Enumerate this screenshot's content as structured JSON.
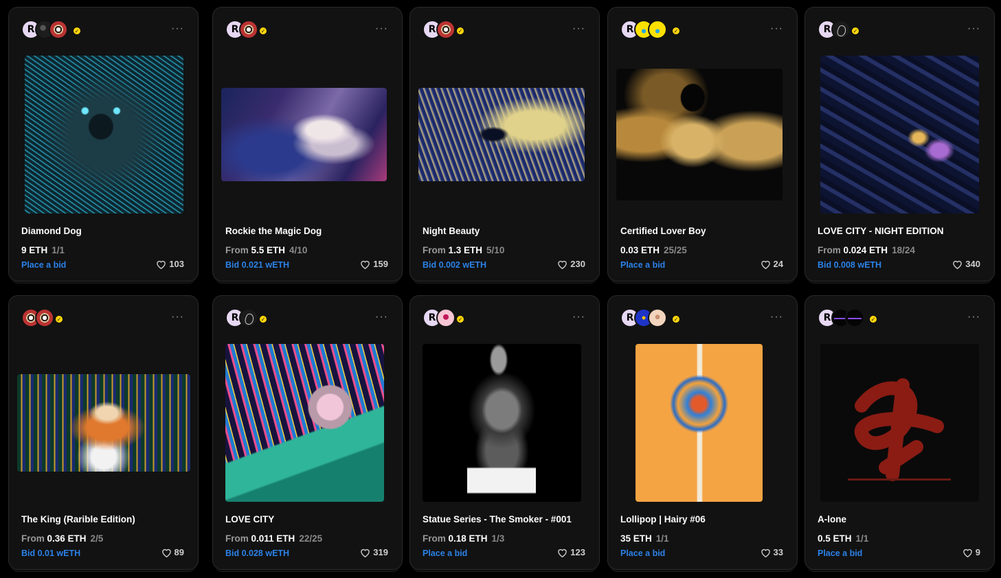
{
  "accent": "#2b82e8",
  "more_glyph": "···",
  "verified_glyph": "✓",
  "cards": [
    {
      "title": "Diamond Dog",
      "from": "",
      "price": "9 ETH",
      "edition": "1/1",
      "bid": "Place a bid",
      "likes": "103"
    },
    {
      "title": "Rockie the Magic Dog",
      "from": "From",
      "price": "5.5 ETH",
      "edition": "4/10",
      "bid": "Bid 0.021 wETH",
      "likes": "159"
    },
    {
      "title": "Night Beauty",
      "from": "From",
      "price": "1.3 ETH",
      "edition": "5/10",
      "bid": "Bid 0.002 wETH",
      "likes": "230"
    },
    {
      "title": "Certified Lover Boy",
      "from": "",
      "price": "0.03 ETH",
      "edition": "25/25",
      "bid": "Place a bid",
      "likes": "24"
    },
    {
      "title": "LOVE CITY - NIGHT EDITION",
      "from": "From",
      "price": "0.024 ETH",
      "edition": "18/24",
      "bid": "Bid 0.008 wETH",
      "likes": "340"
    },
    {
      "title": "The King (Rarible Edition)",
      "from": "From",
      "price": "0.36 ETH",
      "edition": "2/5",
      "bid": "Bid 0.01 wETH",
      "likes": "89"
    },
    {
      "title": "LOVE CITY",
      "from": "From",
      "price": "0.011 ETH",
      "edition": "22/25",
      "bid": "Bid 0.028 wETH",
      "likes": "319"
    },
    {
      "title": "Statue Series - The Smoker - #001",
      "from": "From",
      "price": "0.18 ETH",
      "edition": "1/3",
      "bid": "Place a bid",
      "likes": "123"
    },
    {
      "title": "Lollipop | Hairy #06",
      "from": "",
      "price": "35 ETH",
      "edition": "1/1",
      "bid": "Place a bid",
      "likes": "33"
    },
    {
      "title": "A-lone",
      "from": "",
      "price": "0.5 ETH",
      "edition": "1/1",
      "bid": "Place a bid",
      "likes": "9"
    }
  ]
}
